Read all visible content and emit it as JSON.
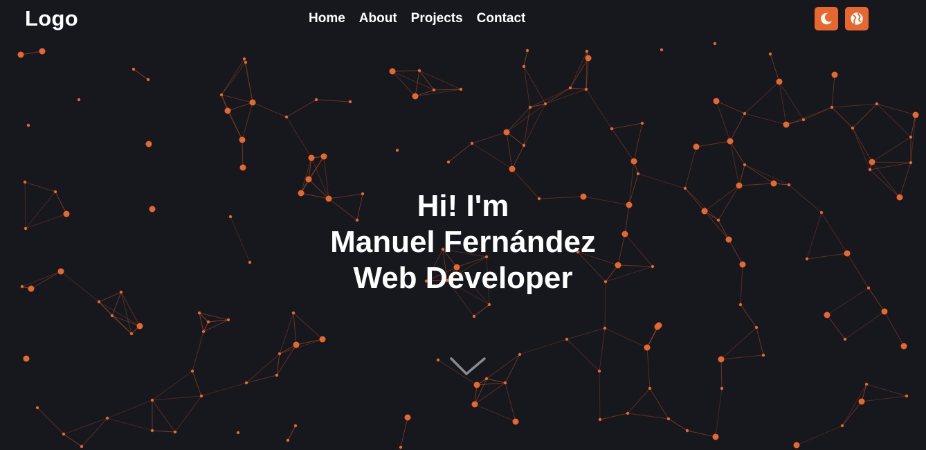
{
  "header": {
    "logo": "Logo",
    "nav": [
      {
        "label": "Home"
      },
      {
        "label": "About"
      },
      {
        "label": "Projects"
      },
      {
        "label": "Contact"
      }
    ],
    "theme_toggle_icon": "moon-icon",
    "language_toggle_icon": "globe-icon"
  },
  "hero": {
    "greeting": "Hi! I'm",
    "name": "Manuel Fernández",
    "role": "Web Developer"
  },
  "scroll_indicator_icon": "chevron-down-icon",
  "colors": {
    "background": "#17181d",
    "accent": "#e8672f",
    "text": "#ffffff",
    "line": "#c0552a"
  }
}
